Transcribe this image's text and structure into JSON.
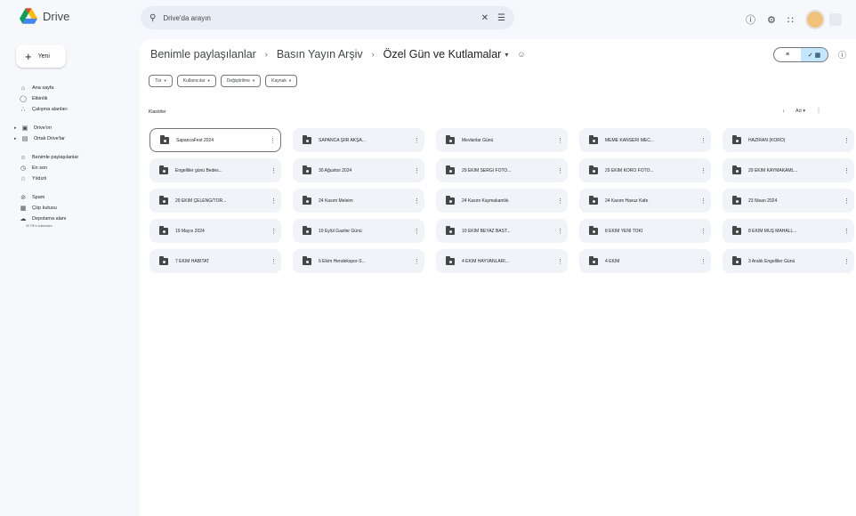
{
  "app": {
    "name": "Drive",
    "search_placeholder": "Drive'da arayın"
  },
  "sidebar": {
    "new_label": "Yeni",
    "items": [
      {
        "label": "Ana sayfa",
        "icon": "home-icon"
      },
      {
        "label": "Etkinlik",
        "icon": "activity-icon"
      },
      {
        "label": "Çalışma alanları",
        "icon": "workspaces-icon"
      },
      {
        "label": "Drive'ım",
        "icon": "my-drive-icon"
      },
      {
        "label": "Ortak Drive'lar",
        "icon": "shared-drives-icon"
      },
      {
        "label": "Benimle paylaşılanlar",
        "icon": "shared-with-me-icon"
      },
      {
        "label": "En son",
        "icon": "recent-icon"
      },
      {
        "label": "Yıldızlı",
        "icon": "starred-icon"
      },
      {
        "label": "Spam",
        "icon": "spam-icon"
      },
      {
        "label": "Çöp kutusu",
        "icon": "trash-icon"
      },
      {
        "label": "Depolama alanı",
        "icon": "storage-icon"
      }
    ],
    "storage_note": "30 TB'ın kullanılanı"
  },
  "breadcrumb": {
    "items": [
      "Benimle paylaşılanlar",
      "Basın Yayın Arşiv",
      "Özel Gün ve Kutlamalar"
    ]
  },
  "filters": [
    "Tür",
    "Kullanıcılar",
    "Değiştirilme",
    "Kaynak"
  ],
  "section": {
    "title": "Klasörler",
    "sort_label": "Ad"
  },
  "folders": [
    "SapancaFest 2024",
    "SAPANCA ŞİİR AKŞA...",
    "Mevlanlar Günü",
    "MEME KANSERİ MEC...",
    "HAZİRAN (KORO)",
    "Engelliler günü Bedes...",
    "30 Ağustos 2024",
    "29 EKİM SERGİ FOTO...",
    "29 EKİM KORO FOTO...",
    "29 EKİM KAYMAKAML...",
    "29 EKİM ÇELENG/TÖR...",
    "24 Kasım Meleim",
    "24 Kasım Kaymakamlık",
    "24 Kasım Havuz Kafe",
    "23 Nisan 2024",
    "19 Mayıs 2024",
    "19 Eylül Gaziler Günü",
    "10 EKİM BEYAZ BAST...",
    "8 EKİM YENİ TOKİ",
    "8 EKİM MUŞ MAHALL...",
    "7 EKİM HABİTAT",
    "6 Ekim Hendekspor-S...",
    "4 EKİM HAYVANLARI...",
    "4 EKİM",
    "3 Aralık Engelliler Günü"
  ]
}
